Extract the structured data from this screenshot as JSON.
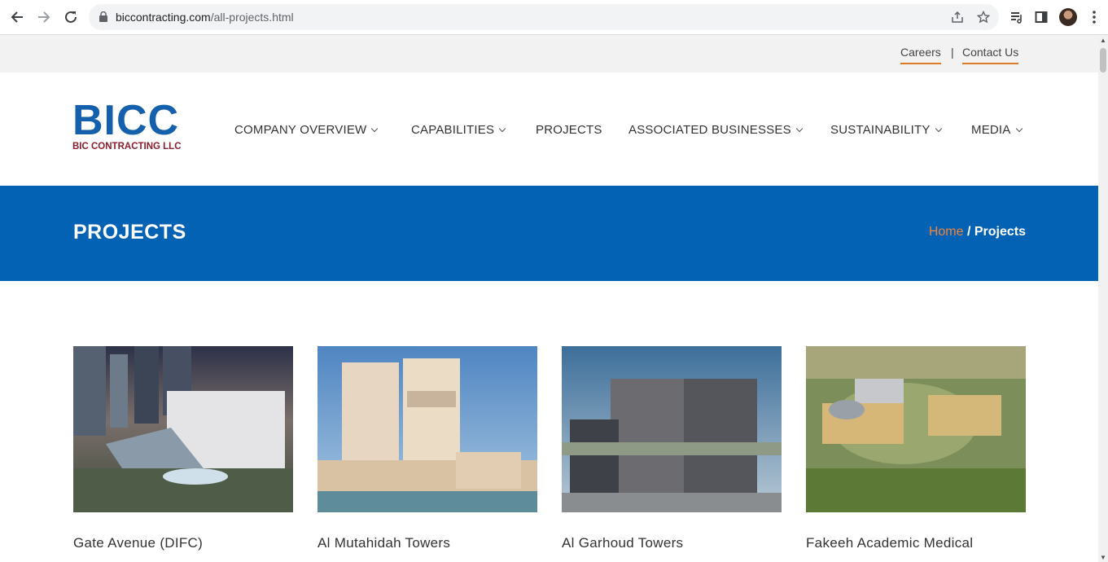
{
  "browser": {
    "url_domain": "biccontracting.com",
    "url_path": "/all-projects.html"
  },
  "topbar": {
    "careers": "Careers",
    "separator": "|",
    "contact": "Contact Us"
  },
  "logo": {
    "big": "BICC",
    "small": "BIC CONTRACTING LLC",
    "colors": {
      "primary": "#1560ad",
      "secondary": "#8b1d2c"
    }
  },
  "nav": {
    "items": [
      {
        "label": "COMPANY OVERVIEW",
        "dropdown": true
      },
      {
        "label": "CAPABILITIES",
        "dropdown": true
      },
      {
        "label": "PROJECTS",
        "dropdown": false
      },
      {
        "label": "ASSOCIATED BUSINESSES",
        "dropdown": true
      },
      {
        "label": "SUSTAINABILITY",
        "dropdown": true
      },
      {
        "label": "MEDIA",
        "dropdown": true
      }
    ]
  },
  "banner": {
    "title": "PROJECTS",
    "breadcrumb_home": "Home",
    "breadcrumb_sep": "/",
    "breadcrumb_current": "Projects",
    "color": "#0462b4",
    "accent": "#f0843a"
  },
  "projects": [
    {
      "title": "Gate Avenue (DIFC)"
    },
    {
      "title": "Al Mutahidah Towers"
    },
    {
      "title": "Al Garhoud Towers"
    },
    {
      "title": "Fakeeh Academic Medical"
    }
  ]
}
